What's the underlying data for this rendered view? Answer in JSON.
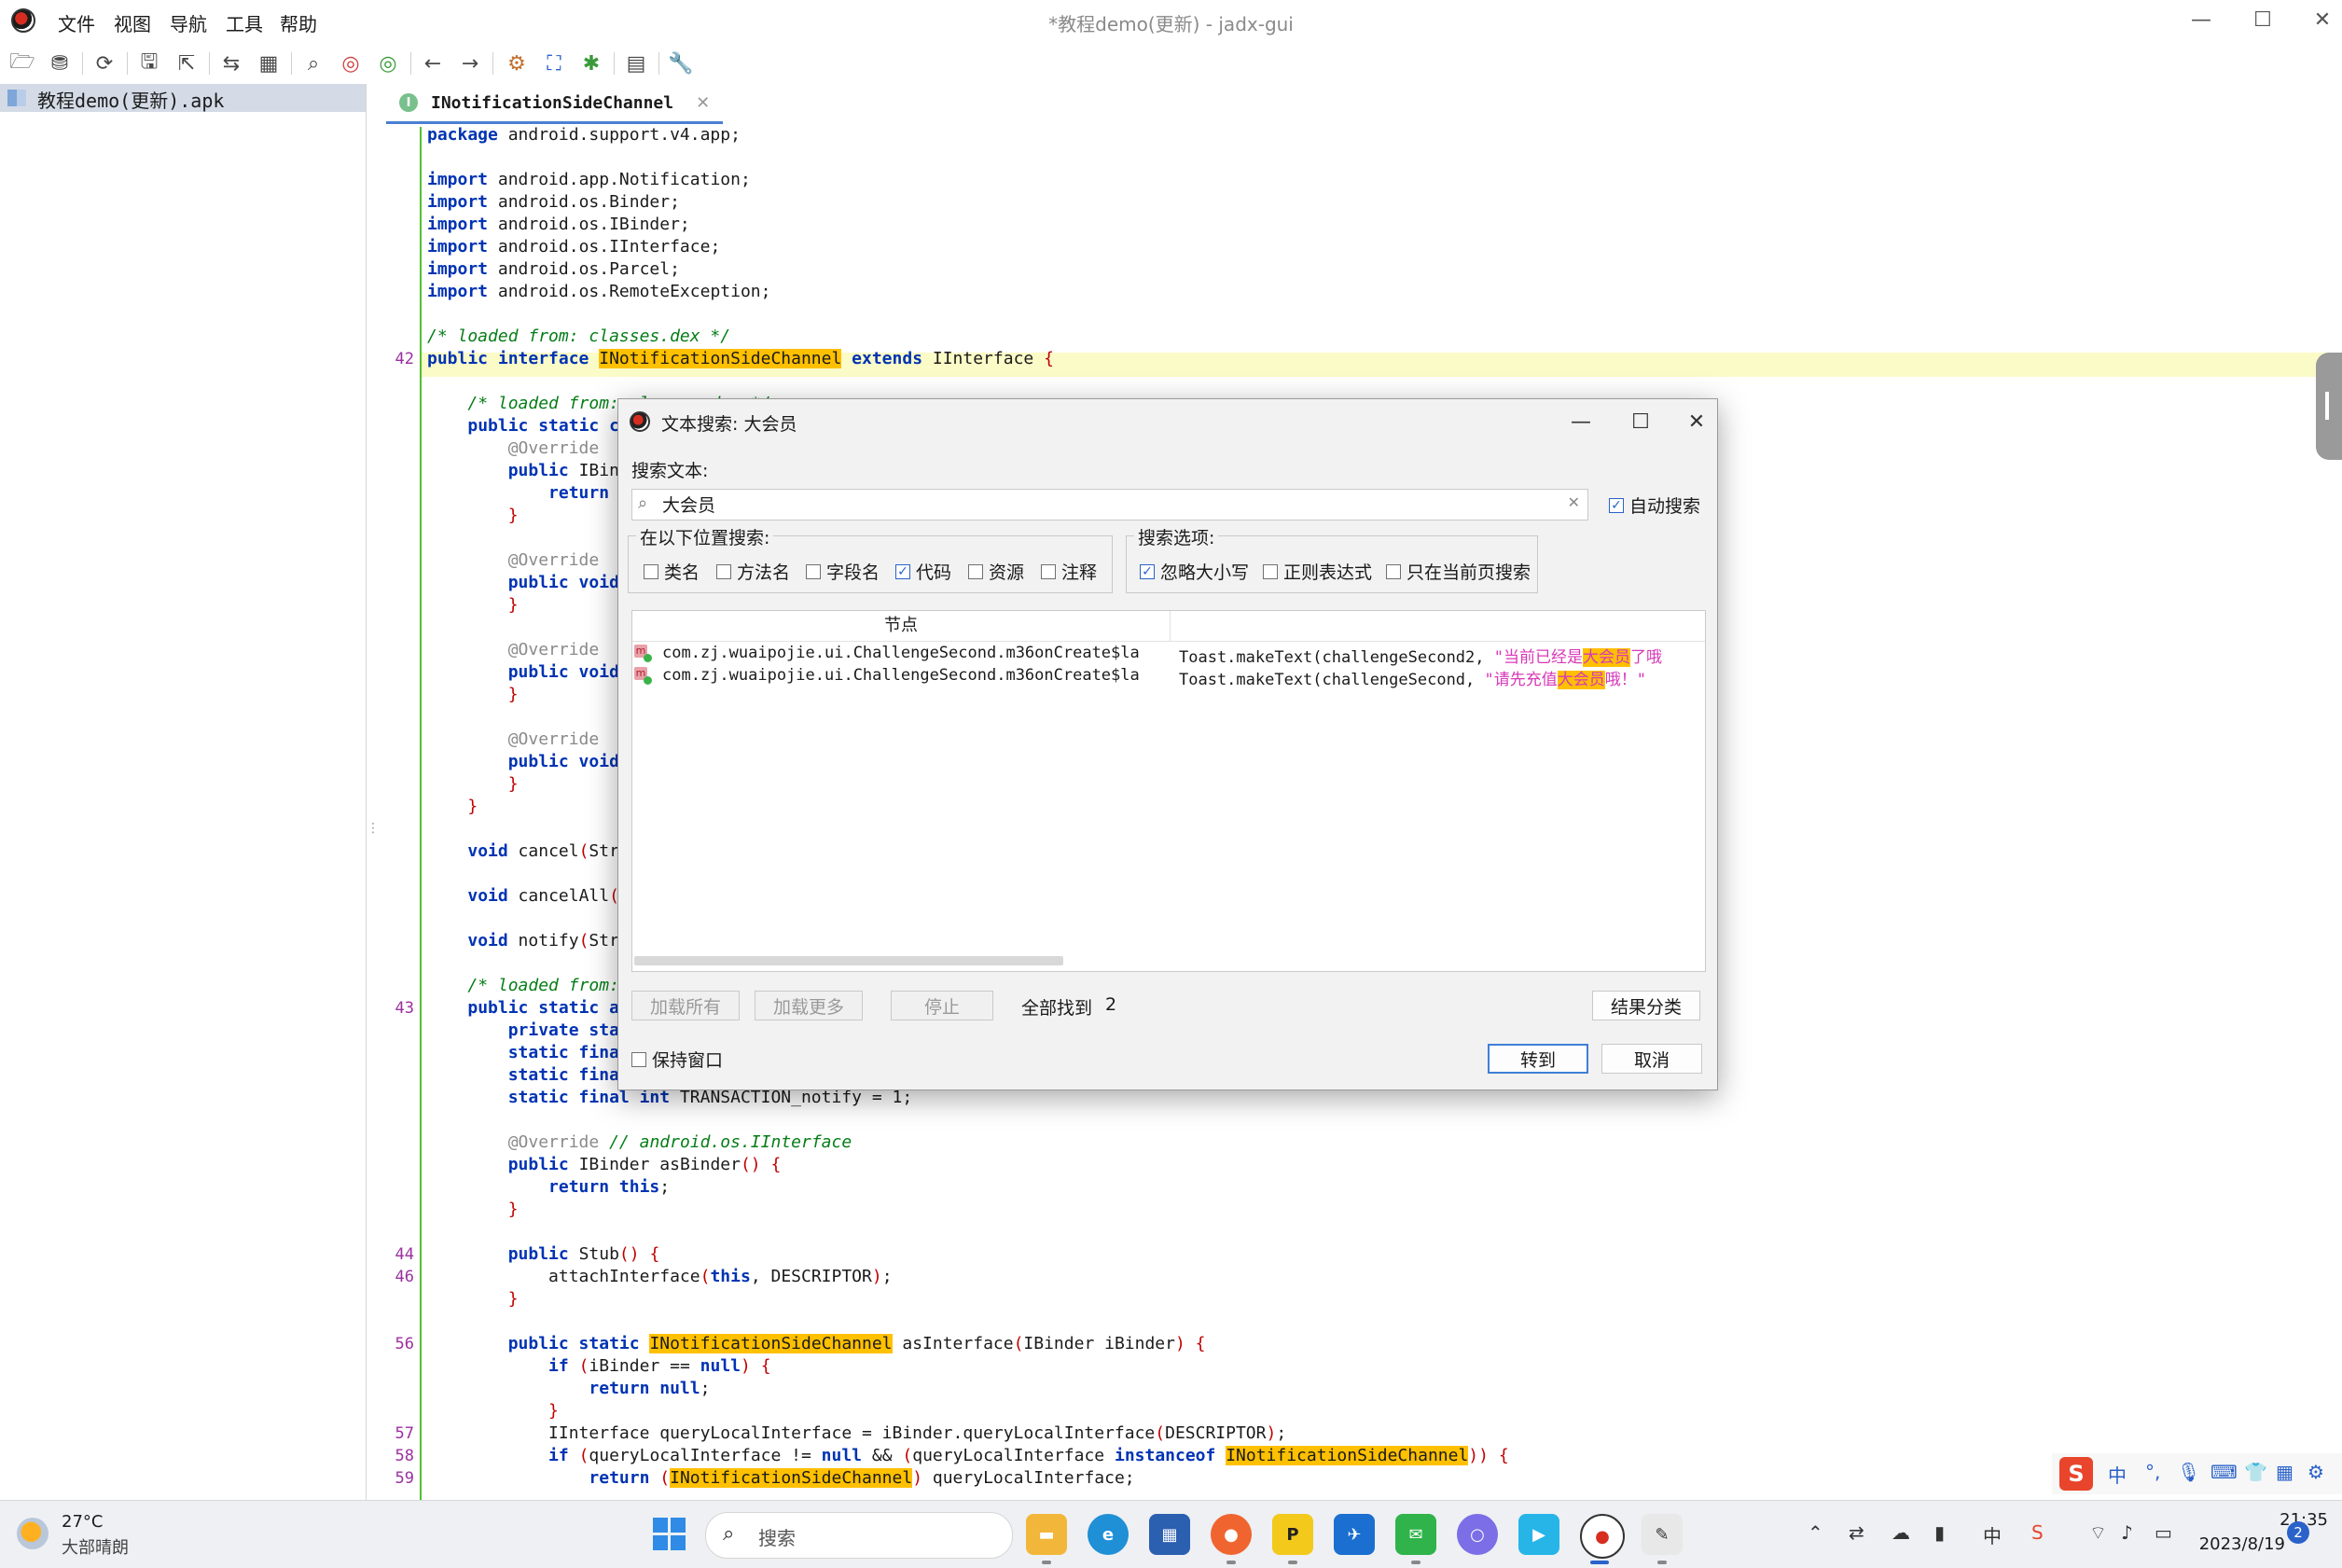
{
  "window": {
    "title": "*教程demo(更新) - jadx-gui",
    "menu": [
      "文件",
      "视图",
      "导航",
      "工具",
      "帮助"
    ]
  },
  "toolbar_icons": [
    "open-file-icon",
    "add-files-icon",
    "sync-icon",
    "save-all-icon",
    "export-icon",
    "sync-tree-icon",
    "flatten-packages-icon",
    "search-icon",
    "find-class-icon",
    "find-usage-icon",
    "back-icon",
    "forward-icon",
    "deobfuscation-icon",
    "quark-icon",
    "debug-icon",
    "log-icon",
    "preferences-icon"
  ],
  "tree": {
    "root_label": "教程demo(更新).apk"
  },
  "tabs": [
    {
      "label": "INotificationSideChannel",
      "icon": "I"
    }
  ],
  "editor": {
    "line_numbers": [
      {
        "n": "42",
        "row": 10
      },
      {
        "n": "43",
        "row": 39
      },
      {
        "n": "44",
        "row": 50
      },
      {
        "n": "46",
        "row": 51
      },
      {
        "n": "56",
        "row": 54
      },
      {
        "n": "57",
        "row": 58
      },
      {
        "n": "58",
        "row": 59
      },
      {
        "n": "59",
        "row": 60
      }
    ]
  },
  "dialog": {
    "title": "文本搜索: 大会员",
    "search_label": "搜索文本:",
    "search_value": "大会员",
    "auto_search_label": "自动搜索",
    "auto_search_checked": true,
    "scope_legend": "在以下位置搜索:",
    "scope": [
      {
        "label": "类名",
        "checked": false
      },
      {
        "label": "方法名",
        "checked": false
      },
      {
        "label": "字段名",
        "checked": false
      },
      {
        "label": "代码",
        "checked": true
      },
      {
        "label": "资源",
        "checked": false
      },
      {
        "label": "注释",
        "checked": false
      }
    ],
    "options_legend": "搜索选项:",
    "options": [
      {
        "label": "忽略大小写",
        "checked": true
      },
      {
        "label": "正则表达式",
        "checked": false
      },
      {
        "label": "只在当前页搜索",
        "checked": false
      }
    ],
    "results_header": "节点",
    "results": [
      {
        "node": "com.zj.wuaipojie.ui.ChallengeSecond.m36onCreate$la",
        "pre": "Toast.makeText(challengeSecond2, ",
        "str_pre": "\"当前已经是",
        "match": "大会员",
        "str_post": "了哦"
      },
      {
        "node": "com.zj.wuaipojie.ui.ChallengeSecond.m36onCreate$la",
        "pre": "Toast.makeText(challengeSecond, ",
        "str_pre": "\"请先充值",
        "match": "大会员",
        "str_post": "哦！\""
      }
    ],
    "load_all": "加载所有",
    "load_more": "加载更多",
    "stop": "停止",
    "found_label": "全部找到",
    "found_count": "2",
    "group_results": "结果分类",
    "keep_open_label": "保持窗口",
    "keep_open_checked": false,
    "goto": "转到",
    "cancel": "取消"
  },
  "taskbar": {
    "weather_temp": "27°C",
    "weather_desc": "大部晴朗",
    "search_placeholder": "搜索",
    "time": "21:35",
    "date": "2023/8/19",
    "notifications": "2",
    "ime_lang": "中"
  },
  "colors": {
    "keyword": "#0033b3",
    "comment": "#067d17",
    "highlight": "#ffc000",
    "accent": "#2a62c9"
  }
}
